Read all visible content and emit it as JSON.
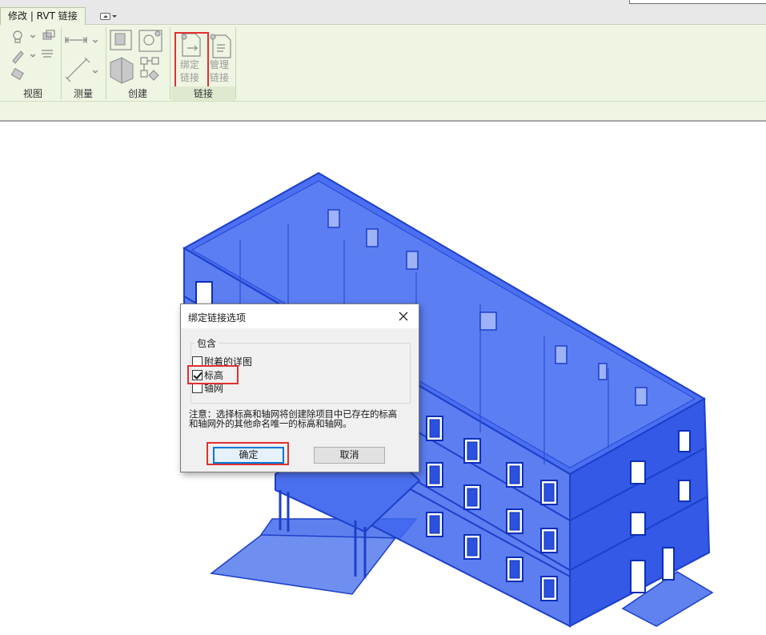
{
  "ribbon": {
    "active_tab": "修改 | RVT 链接",
    "panels": {
      "view": "视图",
      "measure": "测量",
      "create": "创建",
      "link": "链接"
    },
    "bind_link_label_1": "绑定",
    "bind_link_label_2": "链接",
    "manage_link_label_1": "管理",
    "manage_link_label_2": "链接"
  },
  "dialog": {
    "title": "绑定链接选项",
    "group_label": "包含",
    "options": [
      {
        "label": "附着的详图",
        "checked": false
      },
      {
        "label": "标高",
        "checked": true
      },
      {
        "label": "轴网",
        "checked": false
      }
    ],
    "note_line1": "注意：选择标高和轴网将创建除项目中已存在的标高",
    "note_line2": "和轴网外的其他命名唯一的标高和轴网。",
    "ok_label": "确定",
    "cancel_label": "取消"
  },
  "colors": {
    "ribbon_bg": "#eef5e2",
    "model_blue": "#3a63e8",
    "highlight_red": "#e03030",
    "default_button_border": "#0078d7"
  },
  "icons": [
    "lightbulb-icon",
    "brush-icon",
    "dimension-icon",
    "ruler-icon",
    "wall-icon",
    "group-icon",
    "bind-link-icon",
    "manage-links-icon",
    "close-icon"
  ]
}
